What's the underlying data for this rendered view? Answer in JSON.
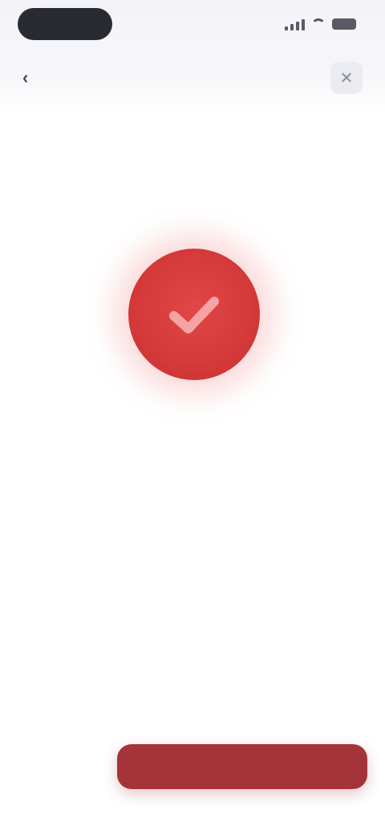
{
  "colors": {
    "accent": "#d63a3a",
    "button": "#a5333a",
    "title": "#c9444a",
    "header_bg": "#f3f4f8"
  },
  "status_bar": {
    "time": "",
    "icons": [
      "signal-icon",
      "wifi-icon",
      "battery-icon"
    ]
  },
  "nav": {
    "back_icon": "chevron-left-icon",
    "back_label": "",
    "right_icon": "close-icon"
  },
  "success": {
    "icon": "check-icon",
    "title": "",
    "headline": "",
    "body_line_1": "",
    "body_line_2": ""
  },
  "actions": {
    "primary_label": "",
    "secondary_label": ""
  }
}
